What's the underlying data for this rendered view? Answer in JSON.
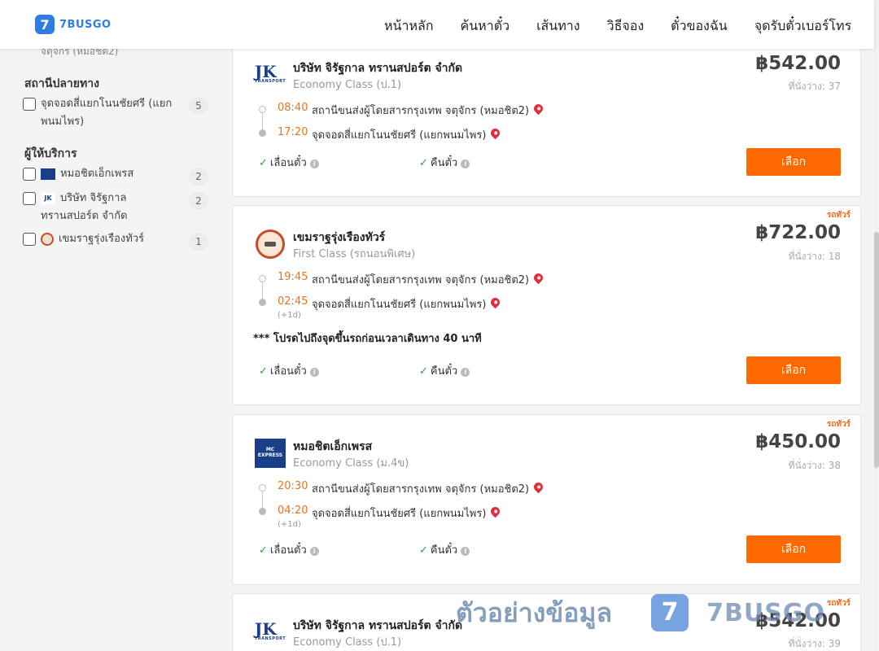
{
  "header": {
    "logo_badge": "7",
    "logo_text": "7BUSGO",
    "nav": [
      "หน้าหลัก",
      "ค้นหาตั๋ว",
      "เส้นทาง",
      "วิธีจอง",
      "ตั๋วของฉัน",
      "จุดรับตั๋วเบอร์โทร"
    ]
  },
  "sidebar": {
    "cut_text": "จตุจักร (หมอชิต2)",
    "destination_heading": "สถานีปลายทาง",
    "destination_items": [
      {
        "label": "จุดจอดสี่แยกโนนชัยศรี (แยกพนมไพร)",
        "count": "5"
      }
    ],
    "operator_heading": "ผู้ให้บริการ",
    "operator_items": [
      {
        "label": "หมอชิตเอ็กเพรส",
        "count": "2",
        "icon": "mc-express-logo-icon"
      },
      {
        "label": "บริษัท จิรัฐกาล ทรานสปอร์ต จำกัด",
        "count": "2",
        "icon": "jk-transport-logo-icon"
      },
      {
        "label": "เขมราฐรุ่งเรืองทัวร์",
        "count": "1",
        "icon": "khemmarat-logo-icon"
      }
    ]
  },
  "common": {
    "change_ticket": "เลื่อนตั๋ว",
    "refund_ticket": "คืนตั๋ว",
    "select": "เลือก",
    "tour_tag": "รถทัวร์",
    "plus_one_day": "(+1d)"
  },
  "trips": [
    {
      "operator": "บริษัท จิรัฐกาล ทรานสปอร์ต จำกัด",
      "logo_text": "JK",
      "logo_sub": "TRANSPORT",
      "class": "Economy Class (ป.1)",
      "price": "฿542.00",
      "seats": "ที่นั่งว่าง: 37",
      "depart_time": "08:40",
      "depart_stop": "สถานีขนส่งผู้โดยสารกรุงเทพ จตุจักร (หมอชิต2)",
      "arrive_time": "17:20",
      "arrive_stop": "จุดจอดสี่แยกโนนชัยศรี (แยกพนมไพร)"
    },
    {
      "operator": "เขมราฐรุ่งเรืองทัวร์",
      "class": "First Class (รถนอนพิเศษ)",
      "price": "฿722.00",
      "seats": "ที่นั่งว่าง: 18",
      "depart_time": "19:45",
      "depart_stop": "สถานีขนส่งผู้โดยสารกรุงเทพ จตุจักร (หมอชิต2)",
      "arrive_time": "02:45",
      "arrive_stop": "จุดจอดสี่แยกโนนชัยศรี (แยกพนมไพร)",
      "note": "*** โปรดไปถึงจุดขึ้นรถก่อนเวลาเดินทาง 40 นาที"
    },
    {
      "operator": "หมอชิตเอ็กเพรส",
      "logo_text": "MC EXPRESS",
      "class": "Economy Class (ม.4ข)",
      "price": "฿450.00",
      "seats": "ที่นั่งว่าง: 38",
      "depart_time": "20:30",
      "depart_stop": "สถานีขนส่งผู้โดยสารกรุงเทพ จตุจักร (หมอชิต2)",
      "arrive_time": "04:20",
      "arrive_stop": "จุดจอดสี่แยกโนนชัยศรี (แยกพนมไพร)"
    },
    {
      "operator": "บริษัท จิรัฐกาล ทรานสปอร์ต จำกัด",
      "logo_text": "JK",
      "logo_sub": "TRANSPORT",
      "class": "Economy Class (ป.1)",
      "price": "฿542.00",
      "seats": "ที่นั่งว่าง: 39"
    }
  ],
  "watermark": {
    "text": "ตัวอย่างข้อมูล",
    "badge": "7",
    "brand": "7BUSGO"
  }
}
